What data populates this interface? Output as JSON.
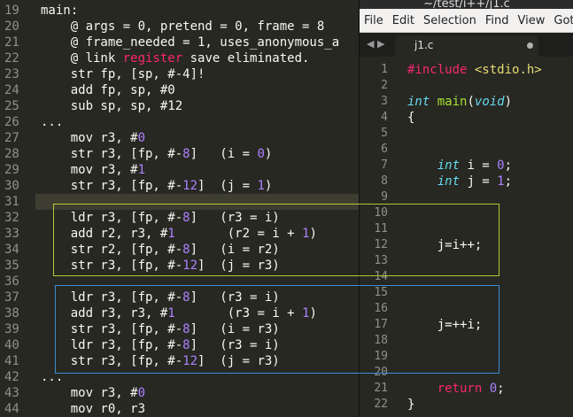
{
  "left_editor": {
    "lines": [
      {
        "n": "19",
        "segs": [
          [
            "main:",
            ""
          ]
        ]
      },
      {
        "n": "20",
        "segs": [
          [
            "    @ args = 0, pretend = 0, frame = 8",
            ""
          ]
        ]
      },
      {
        "n": "21",
        "segs": [
          [
            "    @ frame_needed = 1, uses_anonymous_a",
            ""
          ]
        ]
      },
      {
        "n": "22",
        "segs": [
          [
            "    @ link ",
            ""
          ],
          [
            "register",
            "kw"
          ],
          [
            " save eliminated.",
            ""
          ]
        ]
      },
      {
        "n": "23",
        "segs": [
          [
            "    str fp, [sp, #-4]!",
            ""
          ]
        ]
      },
      {
        "n": "24",
        "segs": [
          [
            "    add fp, sp, #0",
            ""
          ]
        ]
      },
      {
        "n": "25",
        "segs": [
          [
            "    sub sp, sp, #12",
            ""
          ]
        ]
      },
      {
        "n": "26",
        "segs": [
          [
            "...",
            ""
          ]
        ]
      },
      {
        "n": "27",
        "segs": [
          [
            "    mov r3, #",
            ""
          ],
          [
            "0",
            "num"
          ]
        ]
      },
      {
        "n": "28",
        "segs": [
          [
            "    str r3, [fp, #-",
            ""
          ],
          [
            "8",
            "num"
          ],
          [
            "]   (i = ",
            ""
          ],
          [
            "0",
            "num"
          ],
          [
            ")",
            ""
          ]
        ]
      },
      {
        "n": "29",
        "segs": [
          [
            "    mov r3, #",
            ""
          ],
          [
            "1",
            "num"
          ]
        ]
      },
      {
        "n": "30",
        "segs": [
          [
            "    str r3, [fp, #-",
            ""
          ],
          [
            "12",
            "num"
          ],
          [
            "]  (j = ",
            ""
          ],
          [
            "1",
            "num"
          ],
          [
            ")",
            ""
          ]
        ]
      },
      {
        "n": "31",
        "segs": [
          [
            "",
            ""
          ]
        ],
        "highlight": true
      },
      {
        "n": "32",
        "segs": [
          [
            "    ldr r3, [fp, #-",
            ""
          ],
          [
            "8",
            "num"
          ],
          [
            "]   (r3 = i)",
            ""
          ]
        ]
      },
      {
        "n": "33",
        "segs": [
          [
            "    add r2, r3, #",
            ""
          ],
          [
            "1",
            "num"
          ],
          [
            "       (r2 = i + ",
            ""
          ],
          [
            "1",
            "num"
          ],
          [
            ")",
            ""
          ]
        ]
      },
      {
        "n": "34",
        "segs": [
          [
            "    str r2, [fp, #-",
            ""
          ],
          [
            "8",
            "num"
          ],
          [
            "]   (i = r2)",
            ""
          ]
        ]
      },
      {
        "n": "35",
        "segs": [
          [
            "    str r3, [fp, #-",
            ""
          ],
          [
            "12",
            "num"
          ],
          [
            "]  (j = r3)",
            ""
          ]
        ]
      },
      {
        "n": "36",
        "segs": [
          [
            "",
            ""
          ]
        ]
      },
      {
        "n": "37",
        "segs": [
          [
            "    ldr r3, [fp, #-",
            ""
          ],
          [
            "8",
            "num"
          ],
          [
            "]   (r3 = i)",
            ""
          ]
        ]
      },
      {
        "n": "38",
        "segs": [
          [
            "    add r3, r3, #",
            ""
          ],
          [
            "1",
            "num"
          ],
          [
            "       (r3 = i + ",
            ""
          ],
          [
            "1",
            "num"
          ],
          [
            ")",
            ""
          ]
        ]
      },
      {
        "n": "39",
        "segs": [
          [
            "    str r3, [fp, #-",
            ""
          ],
          [
            "8",
            "num"
          ],
          [
            "]   (i = r3)",
            ""
          ]
        ]
      },
      {
        "n": "40",
        "segs": [
          [
            "    ldr r3, [fp, #-",
            ""
          ],
          [
            "8",
            "num"
          ],
          [
            "]   (r3 = i)",
            ""
          ]
        ]
      },
      {
        "n": "41",
        "segs": [
          [
            "    str r3, [fp, #-",
            ""
          ],
          [
            "12",
            "num"
          ],
          [
            "]  (j = r3)",
            ""
          ]
        ]
      },
      {
        "n": "42",
        "segs": [
          [
            "...",
            ""
          ]
        ]
      },
      {
        "n": "43",
        "segs": [
          [
            "    mov r3, #",
            ""
          ],
          [
            "0",
            "num"
          ]
        ]
      },
      {
        "n": "44",
        "segs": [
          [
            "    mov r0, r3",
            ""
          ]
        ]
      }
    ]
  },
  "right_window": {
    "title": "~/test/i++/j1.c",
    "menu": [
      "File",
      "Edit",
      "Selection",
      "Find",
      "View",
      "Goto"
    ],
    "tab_label": "j1.c",
    "lines": [
      {
        "n": "1",
        "segs": [
          [
            "#include",
            "inc"
          ],
          [
            " ",
            ""
          ],
          [
            "<stdio.h>",
            "str"
          ]
        ]
      },
      {
        "n": "2",
        "segs": [
          [
            "",
            ""
          ]
        ]
      },
      {
        "n": "3",
        "segs": [
          [
            "int",
            "typ"
          ],
          [
            " ",
            ""
          ],
          [
            "main",
            "fn"
          ],
          [
            "(",
            ""
          ],
          [
            "void",
            "typ"
          ],
          [
            ")",
            ""
          ]
        ]
      },
      {
        "n": "4",
        "segs": [
          [
            "{",
            ""
          ]
        ]
      },
      {
        "n": "5",
        "segs": [
          [
            "",
            ""
          ]
        ]
      },
      {
        "n": "6",
        "segs": [
          [
            "",
            ""
          ]
        ]
      },
      {
        "n": "7",
        "segs": [
          [
            "    ",
            ""
          ],
          [
            "int",
            "typ"
          ],
          [
            " i = ",
            ""
          ],
          [
            "0",
            "num"
          ],
          [
            ";",
            ""
          ]
        ]
      },
      {
        "n": "8",
        "segs": [
          [
            "    ",
            ""
          ],
          [
            "int",
            "typ"
          ],
          [
            " j = ",
            ""
          ],
          [
            "1",
            "num"
          ],
          [
            ";",
            ""
          ]
        ]
      },
      {
        "n": "9",
        "segs": [
          [
            "",
            ""
          ]
        ]
      },
      {
        "n": "10",
        "segs": [
          [
            "",
            ""
          ]
        ]
      },
      {
        "n": "11",
        "segs": [
          [
            "",
            ""
          ]
        ]
      },
      {
        "n": "12",
        "segs": [
          [
            "    j=i++;",
            ""
          ]
        ]
      },
      {
        "n": "13",
        "segs": [
          [
            "",
            ""
          ]
        ]
      },
      {
        "n": "14",
        "segs": [
          [
            "",
            ""
          ]
        ]
      },
      {
        "n": "15",
        "segs": [
          [
            "",
            ""
          ]
        ]
      },
      {
        "n": "16",
        "segs": [
          [
            "",
            ""
          ]
        ]
      },
      {
        "n": "17",
        "segs": [
          [
            "    j=++i;",
            ""
          ]
        ]
      },
      {
        "n": "18",
        "segs": [
          [
            "",
            ""
          ]
        ]
      },
      {
        "n": "19",
        "segs": [
          [
            "",
            ""
          ]
        ]
      },
      {
        "n": "20",
        "segs": [
          [
            "",
            ""
          ]
        ]
      },
      {
        "n": "21",
        "segs": [
          [
            "    ",
            ""
          ],
          [
            "return",
            "inc"
          ],
          [
            " ",
            ""
          ],
          [
            "0",
            "num"
          ],
          [
            ";",
            ""
          ]
        ]
      },
      {
        "n": "22",
        "segs": [
          [
            "}",
            ""
          ]
        ]
      }
    ]
  },
  "colors": {
    "box_post_increment": "#b4c832",
    "box_pre_increment": "#3c8cd2"
  }
}
